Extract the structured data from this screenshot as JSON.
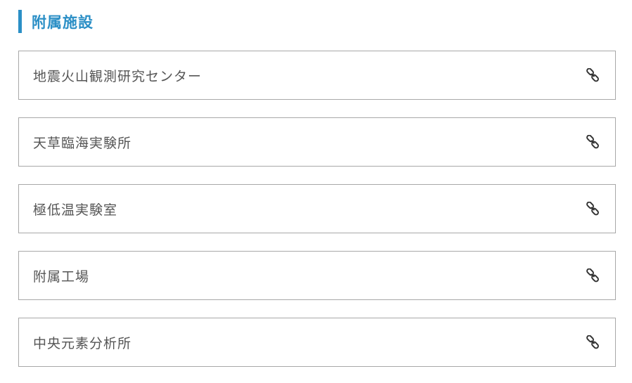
{
  "section": {
    "title": "附属施設",
    "accent_color": "#2b8fc6"
  },
  "facilities": [
    {
      "label": "地震火山観測研究センター",
      "icon": "link-icon"
    },
    {
      "label": "天草臨海実験所",
      "icon": "link-icon"
    },
    {
      "label": "極低温実験室",
      "icon": "link-icon"
    },
    {
      "label": "附属工場",
      "icon": "link-icon"
    },
    {
      "label": "中央元素分析所",
      "icon": "link-icon"
    }
  ]
}
